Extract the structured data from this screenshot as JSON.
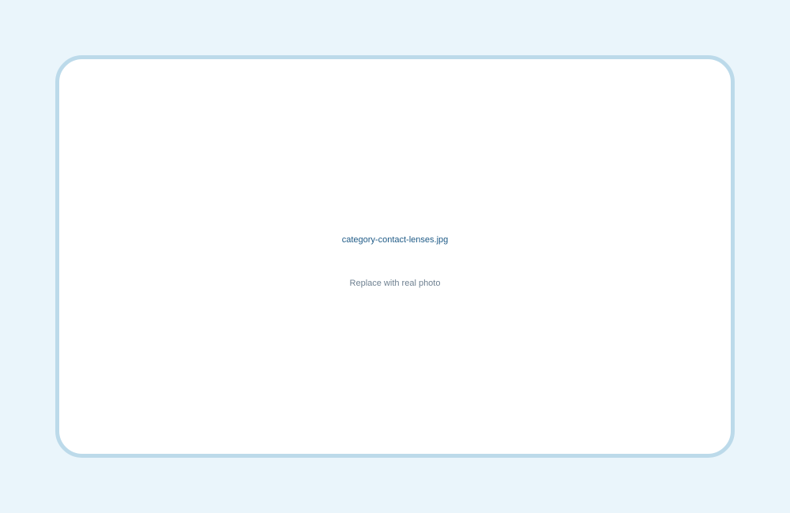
{
  "placeholder": {
    "filename": "category-contact-lenses.jpg",
    "hint": "Replace with real photo"
  },
  "colors": {
    "page_background": "#eaf5fb",
    "card_background": "#ffffff",
    "card_border": "#bcdaea",
    "filename_text": "#1f5b87",
    "hint_text": "#6f8191"
  }
}
